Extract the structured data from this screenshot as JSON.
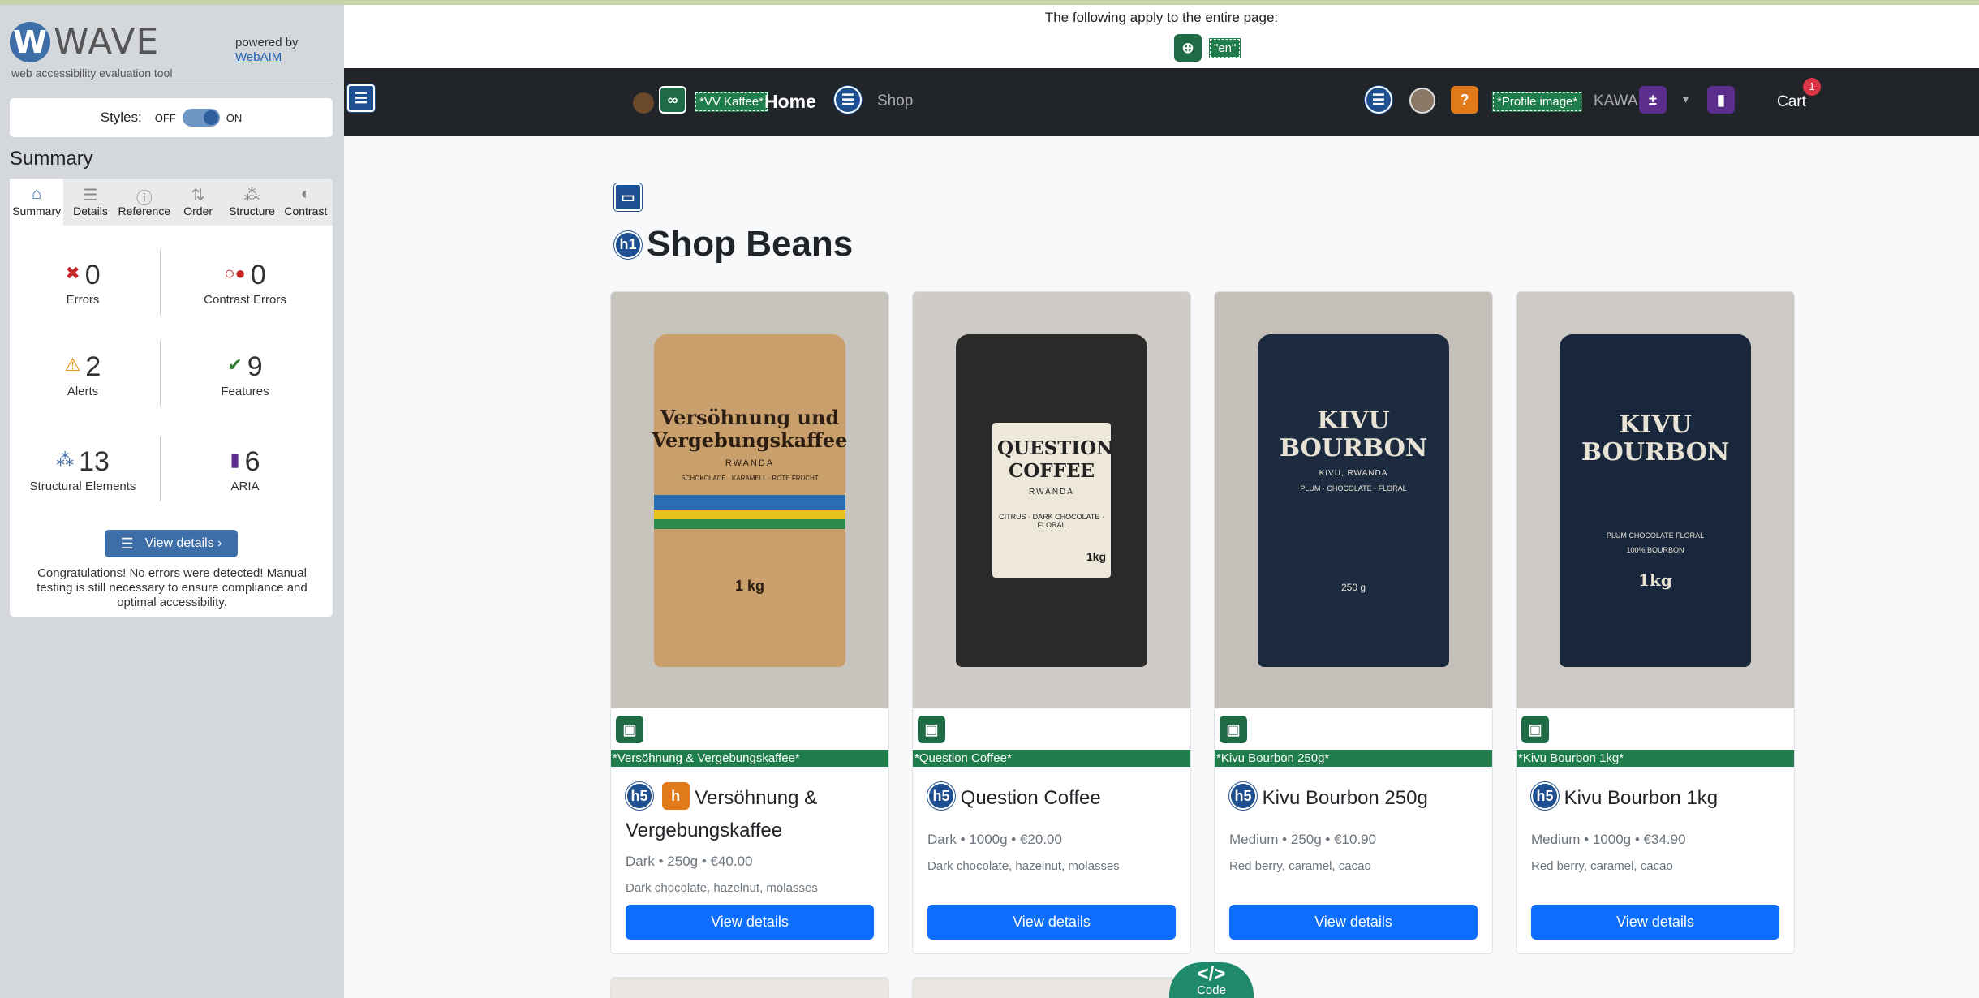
{
  "wave": {
    "logo_letter": "W",
    "logo_word": "WAVE",
    "tagline": "web accessibility evaluation tool",
    "powered_by": "powered by",
    "webaim": "WebAIM",
    "styles_label": "Styles:",
    "styles_off": "OFF",
    "styles_on": "ON",
    "summary_title": "Summary",
    "tabs": [
      {
        "label": "Summary",
        "icon": "home-icon"
      },
      {
        "label": "Details",
        "icon": "list-icon"
      },
      {
        "label": "Reference",
        "icon": "info-icon"
      },
      {
        "label": "Order",
        "icon": "order-icon"
      },
      {
        "label": "Structure",
        "icon": "structure-icon"
      },
      {
        "label": "Contrast",
        "icon": "contrast-icon"
      }
    ],
    "stats": {
      "errors": {
        "value": "0",
        "label": "Errors"
      },
      "contrast_errors": {
        "value": "0",
        "label": "Contrast Errors"
      },
      "alerts": {
        "value": "2",
        "label": "Alerts"
      },
      "features": {
        "value": "9",
        "label": "Features"
      },
      "structural": {
        "value": "13",
        "label": "Structural Elements"
      },
      "aria": {
        "value": "6",
        "label": "ARIA"
      }
    },
    "view_details": "View details ›",
    "congrats": "Congratulations! No errors were detected! Manual testing is still necessary to ensure compliance and optimal accessibility."
  },
  "page": {
    "apply_text": "The following apply to the entire page:",
    "lang_tag": "\"en\"",
    "nav": {
      "brand_tag": "*VV Kaffee*",
      "home": "Home",
      "shop": "Shop",
      "profile_tag": "*Profile image*",
      "user": "KAWA",
      "cart": "Cart",
      "cart_count": "1"
    },
    "heading": "Shop Beans",
    "code_label": "Code",
    "products": [
      {
        "alt": "*Versöhnung & Vergebungskaffee*",
        "heading_tag": "h5",
        "title": "Versöhnung & Vergebungskaffee",
        "meta": "Dark • 250g • €40.00",
        "notes": "Dark chocolate, hazelnut, molasses",
        "button": "View details",
        "bag_title": "Versöhnung und Vergebungskaffee",
        "bag_sub": "RWANDA",
        "bag_notes": "SCHOKOLADE · KARAMELL · ROTE FRUCHT",
        "bag_weight": "1 kg",
        "colors": {
          "bag": "#c9a06b",
          "bg": "#c7c3bd",
          "text": "#2b1d12"
        }
      },
      {
        "alt": "*Question Coffee*",
        "heading_tag": "h5",
        "title": "Question Coffee",
        "meta": "Dark • 1000g • €20.00",
        "notes": "Dark chocolate, hazelnut, molasses",
        "button": "View details",
        "bag_title": "QUESTION COFFEE",
        "bag_sub": "RWANDA",
        "bag_notes": "CITRUS · DARK CHOCOLATE · FLORAL",
        "bag_weight": "1kg",
        "colors": {
          "bag": "#2a2a2a",
          "bg": "#cfcbc6",
          "text": "#222222"
        }
      },
      {
        "alt": "*Kivu Bourbon 250g*",
        "heading_tag": "h5",
        "title": "Kivu Bourbon 250g",
        "meta": "Medium • 250g • €10.90",
        "notes": "Red berry, caramel, cacao",
        "button": "View details",
        "bag_title": "KIVU BOURBON",
        "bag_sub": "KIVU, RWANDA",
        "bag_notes": "PLUM · CHOCOLATE · FLORAL",
        "bag_weight": "250 g",
        "colors": {
          "bag": "#1c2b40",
          "bg": "#c4bfb9",
          "text": "#e8e2d4"
        }
      },
      {
        "alt": "*Kivu Bourbon 1kg*",
        "heading_tag": "h5",
        "title": "Kivu Bourbon 1kg",
        "meta": "Medium • 1000g • €34.90",
        "notes": "Red berry, caramel, cacao",
        "button": "View details",
        "bag_title": "KIVU BOURBON",
        "bag_sub": "100% BOURBON",
        "bag_notes": "PLUM CHOCOLATE FLORAL",
        "bag_weight": "1kg",
        "colors": {
          "bag": "#18273c",
          "bg": "#cdc9c4",
          "text": "#e8e2d4"
        }
      }
    ]
  }
}
